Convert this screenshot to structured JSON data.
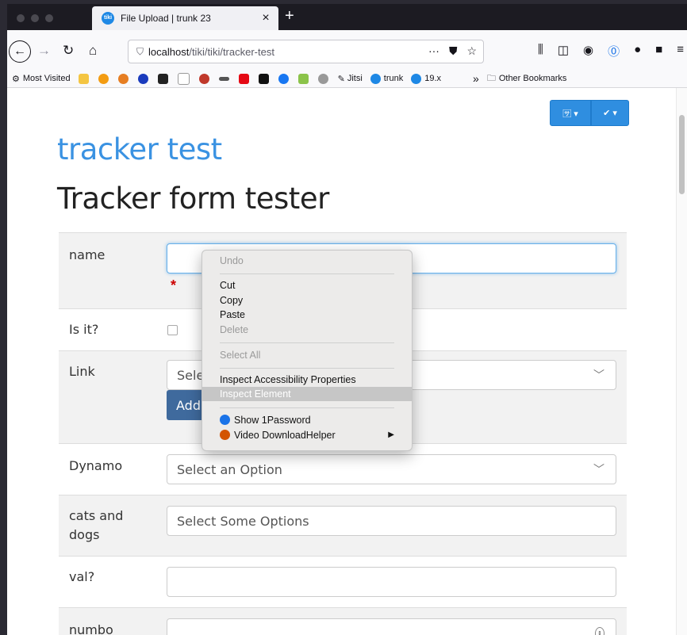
{
  "browser": {
    "tab_title": "File Upload | trunk 23",
    "tab_favicon": "tiki-icon",
    "new_tab_label": "+",
    "close_tab_label": "×",
    "url_host": "localhost",
    "url_path": "/tiki/tiki/tracker-test",
    "url_more": "···",
    "bookmarks": {
      "most_visited": "Most Visited",
      "jitsi": "Jitsi",
      "trunk": "trunk",
      "version": "19.x",
      "overflow": "»",
      "other": "Other Bookmarks"
    }
  },
  "page": {
    "site_title": "tracker test",
    "page_title": "Tracker form tester"
  },
  "form": {
    "name_label": "name",
    "required_marker": "*",
    "isit_label": "Is it?",
    "link_label": "Link",
    "link_placeholder": "Selec",
    "add_label": "Add",
    "dynamo_label": "Dynamo",
    "dynamo_placeholder": "Select an Option",
    "cats_label_1": "cats and",
    "cats_label_2": "dogs",
    "cats_placeholder": "Select Some Options",
    "val_label": "val?",
    "numbo_label": "numbo"
  },
  "context_menu": {
    "undo": "Undo",
    "cut": "Cut",
    "copy": "Copy",
    "paste": "Paste",
    "delete": "Delete",
    "select_all": "Select All",
    "inspect_accessibility": "Inspect Accessibility Properties",
    "inspect_element": "Inspect Element",
    "show_1password": "Show 1Password",
    "video_downloadhelper": "Video DownloadHelper",
    "submenu_arrow": "▶"
  }
}
